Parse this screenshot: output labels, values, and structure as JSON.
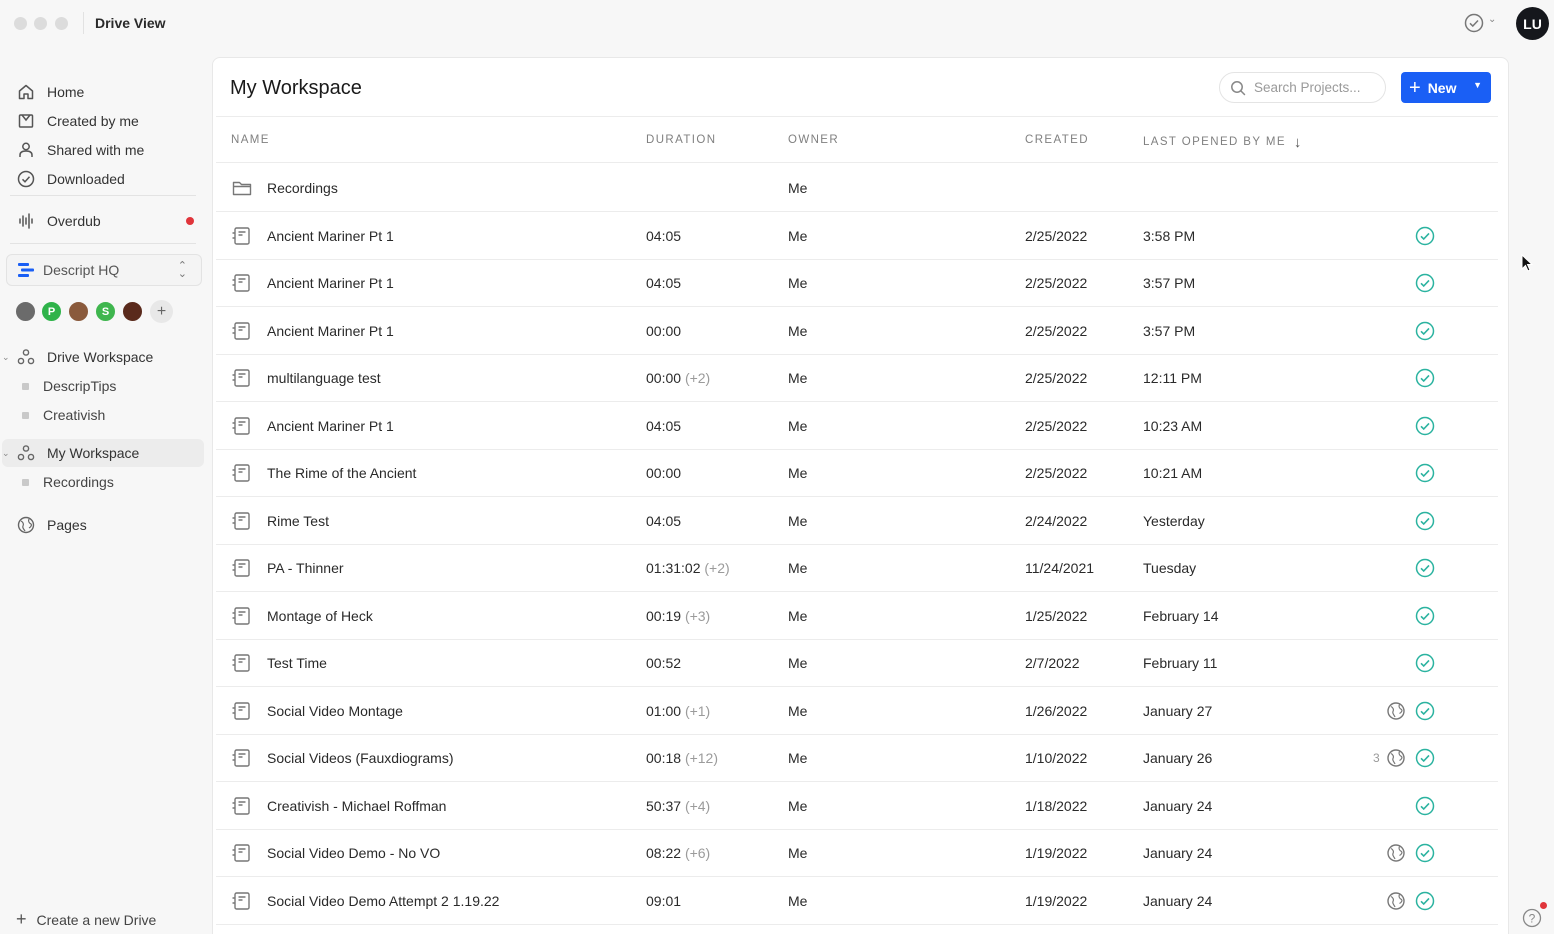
{
  "window": {
    "title": "Drive View",
    "avatar_initials": "LU"
  },
  "sidebar": {
    "nav": [
      {
        "label": "Home",
        "icon": "home-icon"
      },
      {
        "label": "Created by me",
        "icon": "created-icon"
      },
      {
        "label": "Shared with me",
        "icon": "person-icon"
      },
      {
        "label": "Downloaded",
        "icon": "check-circle-icon"
      }
    ],
    "overdub": {
      "label": "Overdub",
      "icon": "waveform-icon",
      "has_notification": true
    },
    "drive_selector": {
      "label": "Descript HQ",
      "icon": "descript-logo-icon"
    },
    "members": [
      {
        "initial": "",
        "color": "#6b6b6b"
      },
      {
        "initial": "P",
        "color": "#2fb34a"
      },
      {
        "initial": "",
        "color": "#8a5a3c"
      },
      {
        "initial": "S",
        "color": "#3fb64e"
      },
      {
        "initial": "",
        "color": "#5a2a1c"
      }
    ],
    "drive_workspace": {
      "label": "Drive Workspace",
      "children": [
        "DescripTips",
        "Creativish"
      ]
    },
    "my_workspace": {
      "label": "My Workspace",
      "children": [
        "Recordings"
      ]
    },
    "pages": {
      "label": "Pages"
    },
    "create_drive": "Create a new Drive"
  },
  "main": {
    "title": "My Workspace",
    "search_placeholder": "Search Projects...",
    "new_button": "New",
    "columns": {
      "name": "NAME",
      "duration": "DURATION",
      "owner": "OWNER",
      "created": "CREATED",
      "last_opened": "LAST OPENED BY ME"
    },
    "rows": [
      {
        "type": "folder",
        "name": "Recordings",
        "duration": "",
        "extra": "",
        "owner": "Me",
        "created": "",
        "last_opened": "",
        "synced": false,
        "shared": false,
        "share_count": ""
      },
      {
        "type": "project",
        "name": "Ancient Mariner Pt 1",
        "duration": "04:05",
        "extra": "",
        "owner": "Me",
        "created": "2/25/2022",
        "last_opened": "3:58 PM",
        "synced": true,
        "shared": false,
        "share_count": ""
      },
      {
        "type": "project",
        "name": "Ancient Mariner Pt 1",
        "duration": "04:05",
        "extra": "",
        "owner": "Me",
        "created": "2/25/2022",
        "last_opened": "3:57 PM",
        "synced": true,
        "shared": false,
        "share_count": ""
      },
      {
        "type": "project",
        "name": "Ancient Mariner Pt 1",
        "duration": "00:00",
        "extra": "",
        "owner": "Me",
        "created": "2/25/2022",
        "last_opened": "3:57 PM",
        "synced": true,
        "shared": false,
        "share_count": ""
      },
      {
        "type": "project",
        "name": "multilanguage test",
        "duration": "00:00",
        "extra": "(+2)",
        "owner": "Me",
        "created": "2/25/2022",
        "last_opened": "12:11 PM",
        "synced": true,
        "shared": false,
        "share_count": ""
      },
      {
        "type": "project",
        "name": "Ancient Mariner Pt 1",
        "duration": "04:05",
        "extra": "",
        "owner": "Me",
        "created": "2/25/2022",
        "last_opened": "10:23 AM",
        "synced": true,
        "shared": false,
        "share_count": ""
      },
      {
        "type": "project",
        "name": "The Rime of the Ancient",
        "duration": "00:00",
        "extra": "",
        "owner": "Me",
        "created": "2/25/2022",
        "last_opened": "10:21 AM",
        "synced": true,
        "shared": false,
        "share_count": ""
      },
      {
        "type": "project",
        "name": "Rime Test",
        "duration": "04:05",
        "extra": "",
        "owner": "Me",
        "created": "2/24/2022",
        "last_opened": "Yesterday",
        "synced": true,
        "shared": false,
        "share_count": ""
      },
      {
        "type": "project",
        "name": "PA - Thinner",
        "duration": "01:31:02",
        "extra": "(+2)",
        "owner": "Me",
        "created": "11/24/2021",
        "last_opened": "Tuesday",
        "synced": true,
        "shared": false,
        "share_count": ""
      },
      {
        "type": "project",
        "name": "Montage of Heck",
        "duration": "00:19",
        "extra": "(+3)",
        "owner": "Me",
        "created": "1/25/2022",
        "last_opened": "February 14",
        "synced": true,
        "shared": false,
        "share_count": ""
      },
      {
        "type": "project",
        "name": "Test Time",
        "duration": "00:52",
        "extra": "",
        "owner": "Me",
        "created": "2/7/2022",
        "last_opened": "February 11",
        "synced": true,
        "shared": false,
        "share_count": ""
      },
      {
        "type": "project",
        "name": "Social Video Montage",
        "duration": "01:00",
        "extra": "(+1)",
        "owner": "Me",
        "created": "1/26/2022",
        "last_opened": "January 27",
        "synced": true,
        "shared": true,
        "share_count": ""
      },
      {
        "type": "project",
        "name": "Social Videos (Fauxdiograms)",
        "duration": "00:18",
        "extra": "(+12)",
        "owner": "Me",
        "created": "1/10/2022",
        "last_opened": "January 26",
        "synced": true,
        "shared": true,
        "share_count": "3"
      },
      {
        "type": "project",
        "name": "Creativish - Michael Roffman",
        "duration": "50:37",
        "extra": "(+4)",
        "owner": "Me",
        "created": "1/18/2022",
        "last_opened": "January 24",
        "synced": true,
        "shared": false,
        "share_count": ""
      },
      {
        "type": "project",
        "name": "Social Video Demo - No VO",
        "duration": "08:22",
        "extra": "(+6)",
        "owner": "Me",
        "created": "1/19/2022",
        "last_opened": "January 24",
        "synced": true,
        "shared": true,
        "share_count": ""
      },
      {
        "type": "project",
        "name": "Social Video Demo Attempt 2 1.19.22",
        "duration": "09:01",
        "extra": "",
        "owner": "Me",
        "created": "1/19/2022",
        "last_opened": "January 24",
        "synced": true,
        "shared": true,
        "share_count": ""
      }
    ]
  },
  "colors": {
    "accent": "#1a5ff5",
    "sync_check": "#2bb3a0",
    "notification": "#e0353b"
  }
}
